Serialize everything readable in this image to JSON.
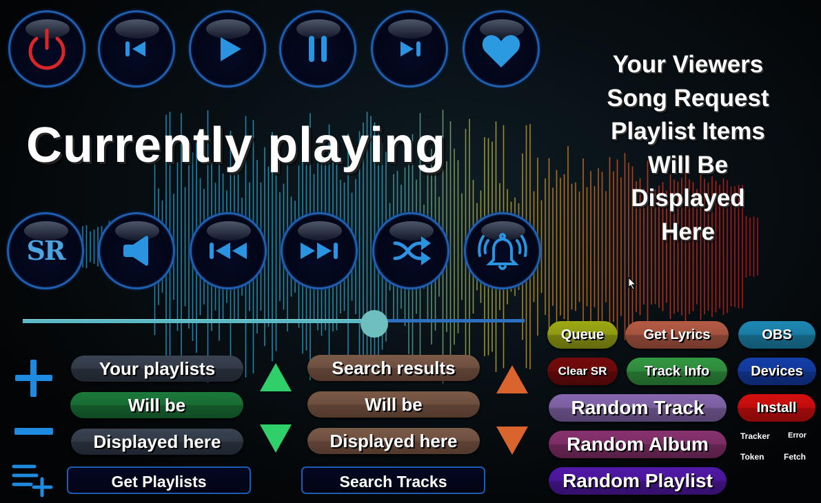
{
  "transport": {
    "row1": [
      {
        "id": "power",
        "icon": "power-icon",
        "color": "#d8262b"
      },
      {
        "id": "previous",
        "icon": "skip-previous-icon",
        "color": "#2b94e0"
      },
      {
        "id": "play",
        "icon": "play-icon",
        "color": "#2b94e0"
      },
      {
        "id": "pause",
        "icon": "pause-icon",
        "color": "#2b94e0"
      },
      {
        "id": "next",
        "icon": "skip-next-icon",
        "color": "#2b94e0"
      },
      {
        "id": "favorite",
        "icon": "heart-icon",
        "color": "#2b94e0"
      }
    ],
    "row2": [
      {
        "id": "song-request",
        "icon": "sr-text-icon",
        "label": "SR"
      },
      {
        "id": "volume",
        "icon": "speaker-icon"
      },
      {
        "id": "rewind",
        "icon": "rewind-icon"
      },
      {
        "id": "fast-forward",
        "icon": "fast-forward-icon"
      },
      {
        "id": "shuffle",
        "icon": "shuffle-icon"
      },
      {
        "id": "alerts",
        "icon": "bell-ringing-icon"
      }
    ]
  },
  "now_playing": {
    "title": "Currently playing"
  },
  "song_request_panel": {
    "lines": [
      "Your Viewers",
      "Song Request",
      "Playlist Items",
      "Will Be",
      "Displayed",
      "Here"
    ]
  },
  "progress": {
    "fraction": 0.7
  },
  "playlists": {
    "add_icon": "plus-icon",
    "remove_icon": "minus-icon",
    "add_to_playlist_icon": "playlist-add-icon",
    "items": [
      "Your playlists",
      "Will be",
      "Displayed here"
    ],
    "get_button": "Get Playlists",
    "up_icon": "triangle-up-icon",
    "down_icon": "triangle-down-icon",
    "arrow_color": "#2fd06a"
  },
  "search": {
    "items": [
      "Search results",
      "Will be",
      "Displayed here"
    ],
    "search_button": "Search Tracks",
    "arrow_color": "#d9642e"
  },
  "actions": {
    "queue": {
      "label": "Queue",
      "color": "#8f9a12"
    },
    "get_lyrics": {
      "label": "Get Lyrics",
      "color": "#a4533f"
    },
    "obs": {
      "label": "OBS",
      "color": "#1a7ca3"
    },
    "clear_sr": {
      "label": "Clear SR",
      "color": "#6a0a0a"
    },
    "track_info": {
      "label": "Track Info",
      "color": "#2e8a3c"
    },
    "devices": {
      "label": "Devices",
      "color": "#12389a"
    },
    "random_track": {
      "label": "Random Track",
      "color": "#7a5e9e"
    },
    "install": {
      "label": "Install",
      "color": "#c10d0d"
    },
    "random_album": {
      "label": "Random Album",
      "color": "#7c2d65"
    },
    "random_playlist": {
      "label": "Random Playlist",
      "color": "#4a1699"
    }
  },
  "status_labels": {
    "tracker": "Tracker",
    "error": "Error",
    "token": "Token",
    "fetch": "Fetch"
  }
}
